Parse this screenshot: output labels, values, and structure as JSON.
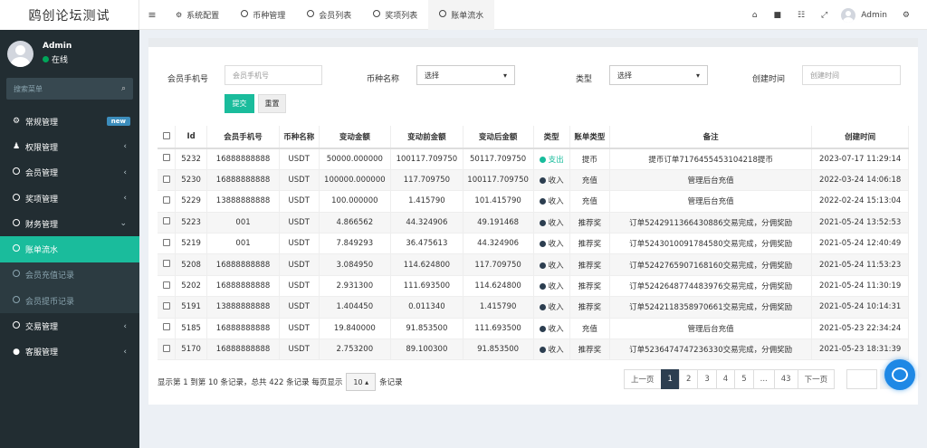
{
  "app": {
    "title": "鸥创论坛测试"
  },
  "user": {
    "name": "Admin",
    "status": "在线"
  },
  "sidebar": {
    "search_placeholder": "搜索菜单",
    "items": [
      {
        "label": "常规管理",
        "icon": "gears-icon",
        "badge": "new"
      },
      {
        "label": "权限管理",
        "icon": "users-icon"
      },
      {
        "label": "会员管理",
        "icon": "circle-icon"
      },
      {
        "label": "奖项管理",
        "icon": "circle-icon"
      },
      {
        "label": "财务管理",
        "icon": "circle-icon"
      }
    ],
    "finance_sub": [
      {
        "label": "账单流水"
      },
      {
        "label": "会员充值记录"
      },
      {
        "label": "会员提币记录"
      }
    ],
    "bottom_items": [
      {
        "label": "交易管理",
        "icon": "circle-icon"
      },
      {
        "label": "客服管理",
        "icon": "comment-icon"
      }
    ]
  },
  "tabs": [
    {
      "label": "系统配置",
      "icon": "gear-icon"
    },
    {
      "label": "币种管理",
      "icon": "circle-icon"
    },
    {
      "label": "会员列表",
      "icon": "circle-icon"
    },
    {
      "label": "奖项列表",
      "icon": "circle-icon"
    },
    {
      "label": "账单流水",
      "icon": "circle-icon"
    }
  ],
  "topbar": {
    "user": "Admin"
  },
  "filters": {
    "phone_label": "会员手机号",
    "phone_placeholder": "会员手机号",
    "coin_label": "币种名称",
    "coin_value": "选择",
    "type_label": "类型",
    "type_value": "选择",
    "time_label": "创建时间",
    "time_placeholder": "创建时间",
    "submit": "提交",
    "reset": "重置"
  },
  "table": {
    "headers": [
      "Id",
      "会员手机号",
      "币种名称",
      "变动金额",
      "变动前金额",
      "变动后金额",
      "类型",
      "账单类型",
      "备注",
      "创建时间"
    ],
    "rows": [
      [
        "5232",
        "16888888888",
        "USDT",
        "50000.000000",
        "100117.709750",
        "50117.709750",
        "支出",
        "提币",
        "提币订单7176455453104218提币",
        "2023-07-17 11:29:14"
      ],
      [
        "5230",
        "16888888888",
        "USDT",
        "100000.000000",
        "117.709750",
        "100117.709750",
        "收入",
        "充值",
        "管理后台充值",
        "2022-03-24 14:06:18"
      ],
      [
        "5229",
        "13888888888",
        "USDT",
        "100.000000",
        "1.415790",
        "101.415790",
        "收入",
        "充值",
        "管理后台充值",
        "2022-02-24 15:13:04"
      ],
      [
        "5223",
        "001",
        "USDT",
        "4.866562",
        "44.324906",
        "49.191468",
        "收入",
        "推荐奖",
        "订单5242911366430886交易完成，分佣奖励",
        "2021-05-24 13:52:53"
      ],
      [
        "5219",
        "001",
        "USDT",
        "7.849293",
        "36.475613",
        "44.324906",
        "收入",
        "推荐奖",
        "订单5243010091784580交易完成，分佣奖励",
        "2021-05-24 12:40:49"
      ],
      [
        "5208",
        "16888888888",
        "USDT",
        "3.084950",
        "114.624800",
        "117.709750",
        "收入",
        "推荐奖",
        "订单5242765907168160交易完成，分佣奖励",
        "2021-05-24 11:53:23"
      ],
      [
        "5202",
        "16888888888",
        "USDT",
        "2.931300",
        "111.693500",
        "114.624800",
        "收入",
        "推荐奖",
        "订单5242648774483976交易完成，分佣奖励",
        "2021-05-24 11:30:19"
      ],
      [
        "5191",
        "13888888888",
        "USDT",
        "1.404450",
        "0.011340",
        "1.415790",
        "收入",
        "推荐奖",
        "订单5242118358970661交易完成，分佣奖励",
        "2021-05-24 10:14:31"
      ],
      [
        "5185",
        "16888888888",
        "USDT",
        "19.840000",
        "91.853500",
        "111.693500",
        "收入",
        "充值",
        "管理后台充值",
        "2021-05-23 22:34:24"
      ],
      [
        "5170",
        "16888888888",
        "USDT",
        "2.753200",
        "89.100300",
        "91.853500",
        "收入",
        "推荐奖",
        "订单5236474747236330交易完成，分佣奖励",
        "2021-05-23 18:31:39"
      ]
    ]
  },
  "footer": {
    "prefix": "显示第 1 到第 10 条记录，总共 422 条记录 每页显示",
    "page_size": "10",
    "suffix": "条记录"
  },
  "pagination": [
    "上一页",
    "1",
    "2",
    "3",
    "4",
    "5",
    "...",
    "43",
    "下一页"
  ],
  "colors": {
    "accent": "#1abc9c",
    "sidebar": "#222d32",
    "income": "#2c3e50",
    "expense": "#18bc9c"
  }
}
